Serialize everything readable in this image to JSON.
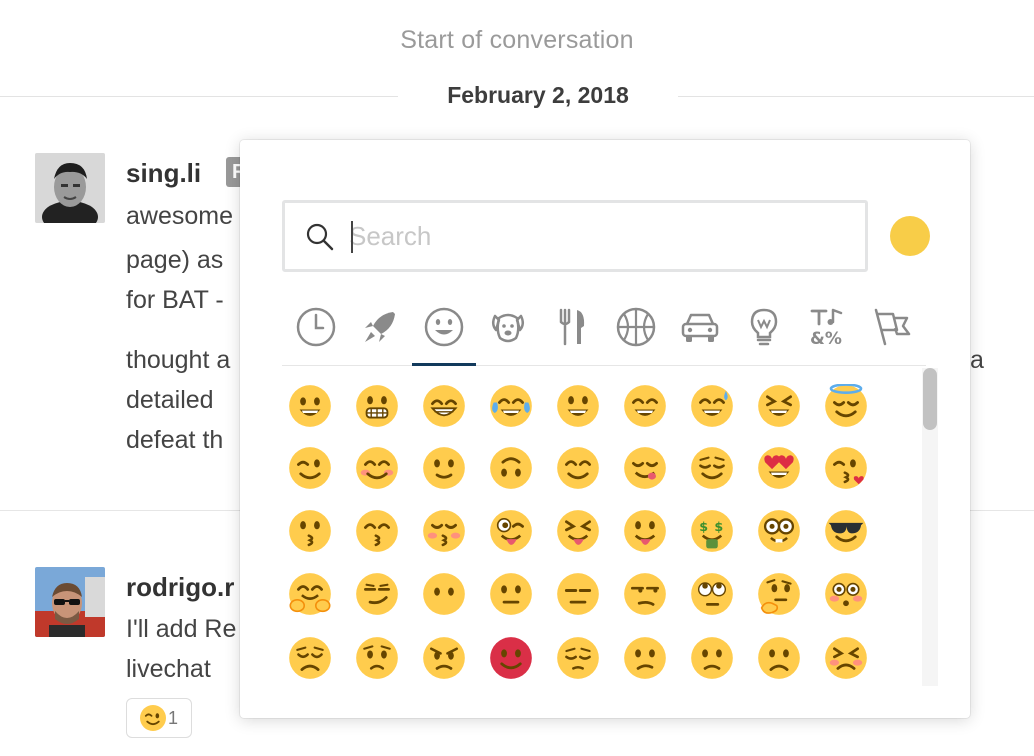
{
  "conversation": {
    "start_label": "Start of conversation",
    "date_label": "February 2, 2018"
  },
  "messages": [
    {
      "author": "sing.li",
      "badge": "R",
      "lines": [
        "awesome",
        "page) as",
        "for BAT -",
        "thought a",
        "detailed",
        "defeat th"
      ],
      "overflow_right": "a"
    },
    {
      "author": "rodrigo.r",
      "lines": [
        "I'll add Re",
        "livechat"
      ],
      "reaction": {
        "emoji": "wink",
        "count": "1"
      }
    }
  ],
  "emoji_picker": {
    "search": {
      "placeholder": "Search",
      "value": ""
    },
    "skin_tone_color": "#f8cd48",
    "accent_color": "#123a5c",
    "categories": [
      {
        "name": "recent",
        "icon": "clock-icon"
      },
      {
        "name": "travel",
        "icon": "rocket-icon"
      },
      {
        "name": "people",
        "icon": "smiley-icon",
        "active": true
      },
      {
        "name": "nature",
        "icon": "dog-icon"
      },
      {
        "name": "food",
        "icon": "fork-knife-icon"
      },
      {
        "name": "activity",
        "icon": "basketball-icon"
      },
      {
        "name": "places",
        "icon": "car-icon"
      },
      {
        "name": "objects",
        "icon": "lightbulb-icon"
      },
      {
        "name": "symbols",
        "icon": "symbols-icon"
      },
      {
        "name": "flags",
        "icon": "flags-icon"
      }
    ],
    "emojis": [
      [
        "grinning",
        "grimacing",
        "grin",
        "joy",
        "smiley",
        "smile",
        "sweat_smile",
        "laughing",
        "innocent"
      ],
      [
        "wink",
        "blush",
        "slightly_smiling_face",
        "upside_down_face",
        "relaxed",
        "yum",
        "relieved",
        "heart_eyes",
        "kissing_heart"
      ],
      [
        "kissing",
        "kissing_smiling_eyes",
        "kissing_closed_eyes",
        "stuck_out_tongue_winking_eye",
        "stuck_out_tongue_closed_eyes",
        "stuck_out_tongue",
        "money_mouth_face",
        "nerd_face",
        "sunglasses"
      ],
      [
        "hugging_face",
        "smirk",
        "no_mouth",
        "neutral_face",
        "expressionless",
        "unamused",
        "face_with_rolling_eyes",
        "thinking_face",
        "flushed"
      ],
      [
        "disappointed",
        "worried",
        "angry",
        "rage",
        "pensive",
        "confused",
        "slightly_frowning_face",
        "frowning",
        "persevere"
      ]
    ]
  }
}
